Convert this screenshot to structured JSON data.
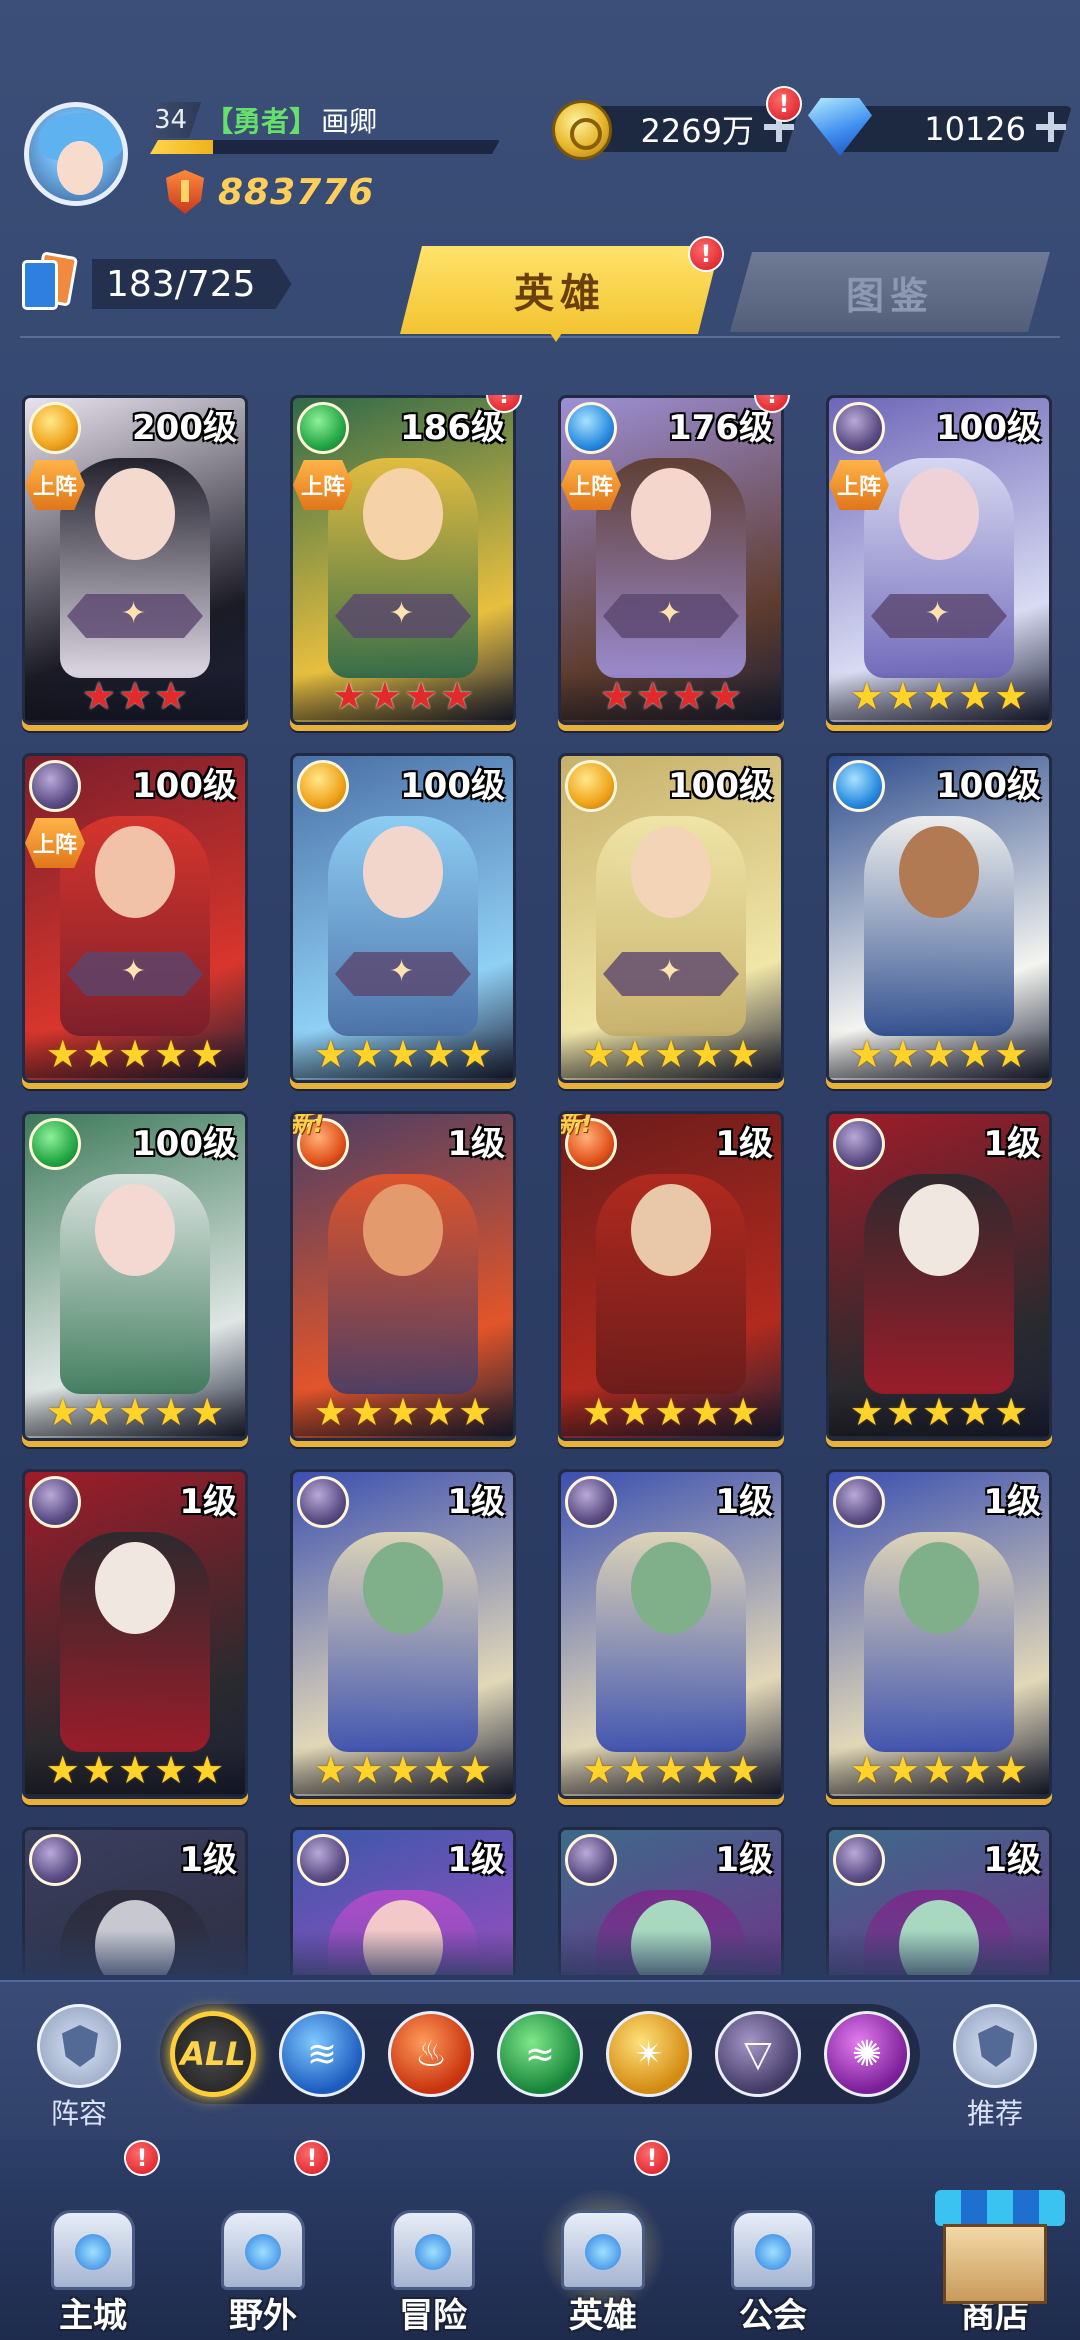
{
  "player": {
    "level": "34",
    "title": "【勇者】",
    "name": "画卿",
    "exp_progress": 0.18,
    "power": "883776"
  },
  "currency": {
    "gold": "2269万",
    "diamond": "10126"
  },
  "hero_count": "183/725",
  "tabs": {
    "hero": "英雄",
    "codex": "图鉴"
  },
  "alert_mark": "!",
  "heroes": [
    {
      "level": "200级",
      "element": "light",
      "on_team": "上阵",
      "star_color": "red",
      "stars": 3,
      "alert": false,
      "new": "",
      "colors": [
        "#e9e2ef",
        "#1b1b26",
        "#f4d9cf"
      ]
    },
    {
      "level": "186级",
      "element": "wind",
      "on_team": "上阵",
      "star_color": "red",
      "stars": 4,
      "alert": true,
      "new": "",
      "colors": [
        "#2f6a4a",
        "#e8bf3f",
        "#f6d2a8"
      ]
    },
    {
      "level": "176级",
      "element": "water",
      "on_team": "上阵",
      "star_color": "red",
      "stars": 4,
      "alert": true,
      "new": "",
      "colors": [
        "#9d8fd6",
        "#5e3c2e",
        "#f4d6cc"
      ]
    },
    {
      "level": "100级",
      "element": "dark",
      "on_team": "上阵",
      "star_color": "gold",
      "stars": 5,
      "alert": false,
      "new": "",
      "colors": [
        "#6d66b8",
        "#d8dbf2",
        "#efd2d8"
      ]
    },
    {
      "level": "100级",
      "element": "dark",
      "on_team": "上阵",
      "star_color": "gold",
      "stars": 5,
      "alert": false,
      "new": "",
      "colors": [
        "#7a1e2c",
        "#d8362c",
        "#f1c2a8"
      ]
    },
    {
      "level": "100级",
      "element": "light",
      "on_team": "",
      "star_color": "gold",
      "stars": 5,
      "alert": false,
      "new": "",
      "colors": [
        "#4a6fa6",
        "#8fd0f5",
        "#f2d6cc"
      ]
    },
    {
      "level": "100级",
      "element": "light",
      "on_team": "",
      "star_color": "gold",
      "stars": 5,
      "alert": false,
      "new": "",
      "colors": [
        "#c7b06a",
        "#f0e6a8",
        "#f3d4b6"
      ]
    },
    {
      "level": "100级",
      "element": "water",
      "on_team": "",
      "star_color": "gold",
      "stars": 5,
      "alert": false,
      "new": "",
      "colors": [
        "#2c4b8c",
        "#f4f4f0",
        "#b27a52"
      ]
    },
    {
      "level": "100级",
      "element": "wind",
      "on_team": "",
      "star_color": "gold",
      "stars": 5,
      "alert": false,
      "new": "",
      "colors": [
        "#3d7a5a",
        "#dfe6e4",
        "#f4d8d2"
      ]
    },
    {
      "level": "1级",
      "element": "fire",
      "on_team": "",
      "star_color": "gold",
      "stars": 5,
      "alert": false,
      "new": "新!",
      "colors": [
        "#4a3e66",
        "#e2552a",
        "#e39a6c"
      ]
    },
    {
      "level": "1级",
      "element": "fire",
      "on_team": "",
      "star_color": "gold",
      "stars": 5,
      "alert": false,
      "new": "新!",
      "colors": [
        "#6a1c1c",
        "#b22a1e",
        "#e8c8a8"
      ]
    },
    {
      "level": "1级",
      "element": "dark",
      "on_team": "",
      "star_color": "gold",
      "stars": 5,
      "alert": false,
      "new": "",
      "colors": [
        "#a01c2a",
        "#2a2a2e",
        "#f0e8e0"
      ]
    },
    {
      "level": "1级",
      "element": "dark",
      "on_team": "",
      "star_color": "gold",
      "stars": 5,
      "alert": false,
      "new": "",
      "colors": [
        "#a01c2a",
        "#2a2a2e",
        "#f0e8e0"
      ]
    },
    {
      "level": "1级",
      "element": "dark",
      "on_team": "",
      "star_color": "gold",
      "stars": 5,
      "alert": false,
      "new": "",
      "colors": [
        "#3b4fb0",
        "#e2d8b8",
        "#7fb08a"
      ]
    },
    {
      "level": "1级",
      "element": "dark",
      "on_team": "",
      "star_color": "gold",
      "stars": 5,
      "alert": false,
      "new": "",
      "colors": [
        "#3b4fb0",
        "#e2d8b8",
        "#7fb08a"
      ]
    },
    {
      "level": "1级",
      "element": "dark",
      "on_team": "",
      "star_color": "gold",
      "stars": 5,
      "alert": false,
      "new": "",
      "colors": [
        "#3b4fb0",
        "#e2d8b8",
        "#7fb08a"
      ]
    },
    {
      "level": "1级",
      "element": "dark",
      "on_team": "",
      "star_color": "gold",
      "stars": 0,
      "alert": false,
      "new": "",
      "colors": [
        "#3a3f60",
        "#2b2b3a",
        "#c8c8d0"
      ]
    },
    {
      "level": "1级",
      "element": "dark",
      "on_team": "",
      "star_color": "gold",
      "stars": 0,
      "alert": false,
      "new": "",
      "colors": [
        "#3a58a8",
        "#b04cc8",
        "#f2c8c8"
      ]
    },
    {
      "level": "1级",
      "element": "dark",
      "on_team": "",
      "star_color": "gold",
      "stars": 0,
      "alert": false,
      "new": "",
      "colors": [
        "#3c6a8a",
        "#7a2a8a",
        "#a8d8c0"
      ]
    },
    {
      "level": "1级",
      "element": "dark",
      "on_team": "",
      "star_color": "gold",
      "stars": 0,
      "alert": false,
      "new": "",
      "colors": [
        "#3c6a8a",
        "#7a2a8a",
        "#a8d8c0"
      ]
    }
  ],
  "filter": {
    "lineup_label": "阵容",
    "all_label": "ALL",
    "recommend_label": "推荐",
    "elements": [
      "water",
      "fire",
      "wind",
      "light",
      "dark",
      "chaos"
    ]
  },
  "nav": [
    {
      "label": "主城",
      "alert": true
    },
    {
      "label": "野外",
      "alert": true
    },
    {
      "label": "冒险",
      "alert": false
    },
    {
      "label": "英雄",
      "alert": true
    },
    {
      "label": "公会",
      "alert": false
    },
    {
      "label": "商店",
      "alert": false
    }
  ],
  "colors": {
    "accent_gold": "#f2c431",
    "alert_red": "#d6141f",
    "bg": "#2f4068"
  }
}
